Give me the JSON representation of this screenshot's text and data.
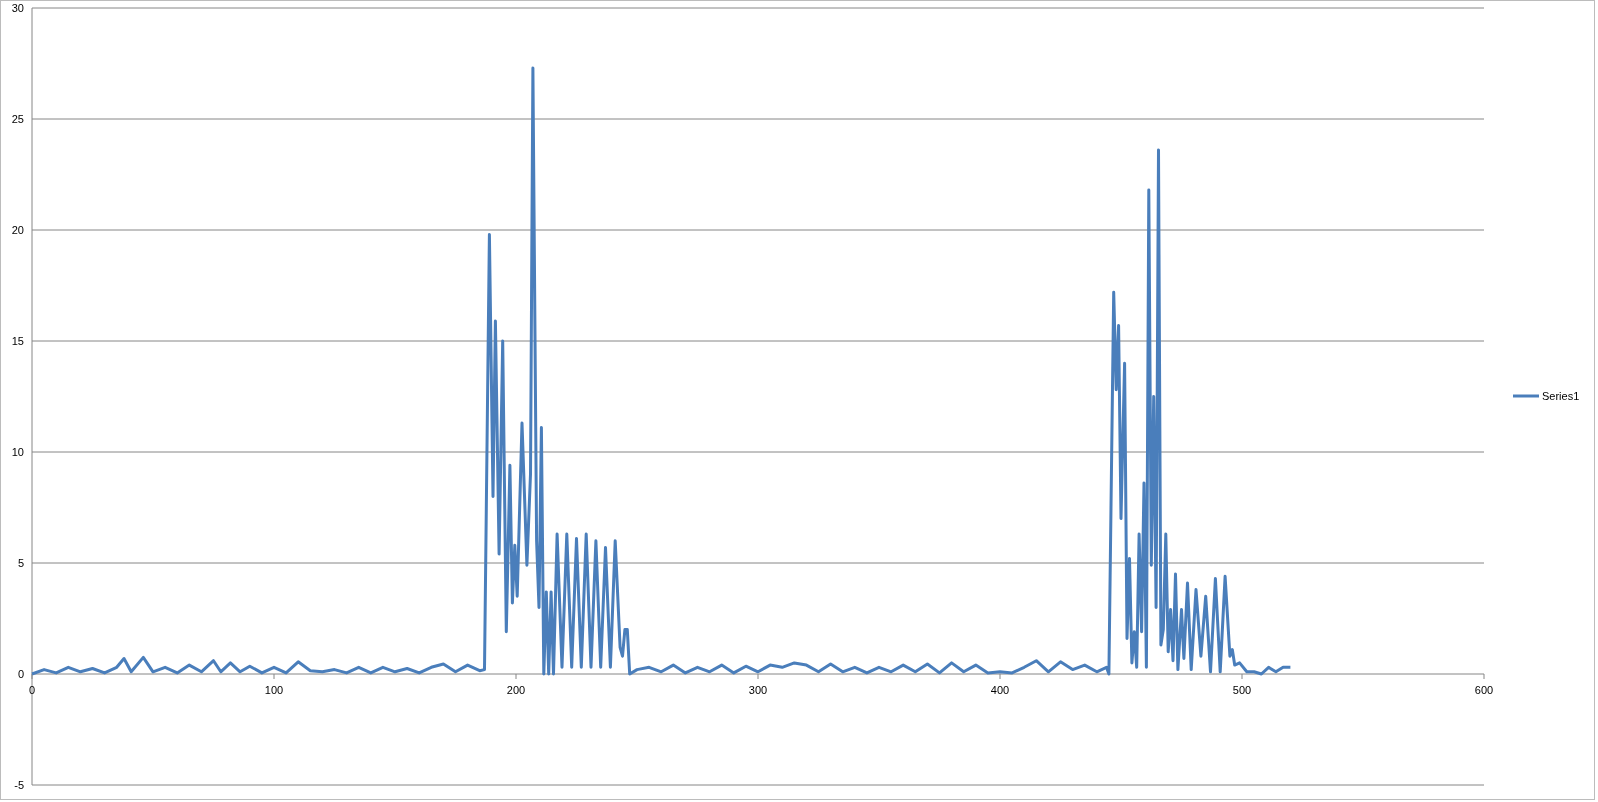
{
  "chart": {
    "chart_data": {
      "type": "line",
      "x": [
        0,
        5,
        10,
        15,
        20,
        25,
        30,
        35,
        38,
        41,
        46,
        50,
        55,
        60,
        65,
        70,
        75,
        78,
        82,
        86,
        90,
        95,
        100,
        105,
        110,
        115,
        120,
        125,
        130,
        135,
        140,
        145,
        150,
        155,
        160,
        165,
        170,
        175,
        180,
        185,
        187,
        189,
        190.5,
        191.5,
        193,
        194.5,
        196,
        197.5,
        198.5,
        199.5,
        200.5,
        202.5,
        204.5,
        206,
        207,
        208.5,
        209.5,
        210.5,
        211.5,
        212.5,
        213.5,
        214.5,
        215.5,
        217,
        219,
        221,
        223,
        225,
        227,
        229,
        231,
        233,
        235,
        237,
        239,
        241,
        243,
        244,
        245,
        246,
        247,
        250,
        255,
        260,
        265,
        270,
        275,
        280,
        285,
        290,
        295,
        300,
        305,
        310,
        315,
        320,
        325,
        330,
        335,
        340,
        345,
        350,
        355,
        360,
        365,
        370,
        375,
        380,
        385,
        390,
        395,
        400,
        405,
        410,
        415,
        420,
        425,
        430,
        435,
        440,
        444,
        445,
        447,
        448,
        449,
        450,
        451.5,
        452.5,
        453.5,
        454.5,
        455.5,
        456.5,
        457.5,
        458.5,
        459.5,
        460.5,
        461.5,
        462.5,
        463.5,
        464.5,
        465.5,
        466.5,
        467.5,
        468.5,
        469.5,
        470.5,
        471.5,
        472.5,
        473.5,
        475,
        476,
        477.5,
        479,
        481,
        483,
        485,
        487,
        489,
        491,
        493,
        495,
        496,
        497,
        499,
        502,
        505,
        508,
        511,
        514,
        517,
        520
      ],
      "series": [
        {
          "name": "Series1",
          "color": "#4a7ebb",
          "values": [
            0,
            0.2,
            0.05,
            0.3,
            0.1,
            0.25,
            0.05,
            0.3,
            0.7,
            0.1,
            0.75,
            0.1,
            0.3,
            0.05,
            0.4,
            0.1,
            0.6,
            0.1,
            0.5,
            0.1,
            0.35,
            0.05,
            0.3,
            0.05,
            0.55,
            0.15,
            0.1,
            0.2,
            0.05,
            0.3,
            0.05,
            0.3,
            0.1,
            0.25,
            0.05,
            0.3,
            0.45,
            0.1,
            0.4,
            0.15,
            0.2,
            19.8,
            8,
            15.9,
            5.4,
            15,
            1.9,
            9.4,
            3.2,
            5.8,
            3.5,
            11.3,
            4.9,
            9,
            27.3,
            6,
            3,
            11.1,
            0,
            3.7,
            0,
            3.7,
            0,
            6.3,
            0.3,
            6.3,
            0.3,
            6.1,
            0.3,
            6.3,
            0.3,
            6,
            0.3,
            5.7,
            0.3,
            6,
            1.2,
            0.8,
            2,
            2,
            0,
            0.2,
            0.3,
            0.1,
            0.4,
            0.05,
            0.3,
            0.1,
            0.4,
            0.05,
            0.35,
            0.1,
            0.4,
            0.3,
            0.5,
            0.4,
            0.1,
            0.45,
            0.1,
            0.3,
            0.05,
            0.3,
            0.1,
            0.4,
            0.1,
            0.45,
            0.05,
            0.5,
            0.1,
            0.4,
            0.05,
            0.1,
            0.05,
            0.3,
            0.6,
            0.1,
            0.55,
            0.2,
            0.4,
            0.1,
            0.3,
            0,
            17.2,
            12.8,
            15.7,
            7,
            14,
            1.6,
            5.2,
            0.5,
            1.9,
            0.3,
            6.3,
            1.9,
            8.6,
            0.3,
            21.8,
            4.9,
            12.5,
            3,
            23.6,
            1.3,
            2,
            6.3,
            1,
            2.9,
            0.6,
            4.5,
            0.2,
            2.9,
            0.7,
            4.1,
            0.2,
            3.8,
            0.8,
            3.5,
            0.1,
            4.3,
            0.1,
            4.4,
            0.8,
            1.1,
            0.4,
            0.5,
            0.1,
            0.1,
            0,
            0.3,
            0.1,
            0.3,
            0.3
          ]
        }
      ],
      "xlim": [
        0,
        600
      ],
      "ylim": [
        -5,
        30
      ],
      "grid": true,
      "xticks": [
        0,
        100,
        200,
        300,
        400,
        500,
        600
      ],
      "yticks": [
        -5,
        0,
        5,
        10,
        15,
        20,
        25,
        30
      ]
    }
  }
}
